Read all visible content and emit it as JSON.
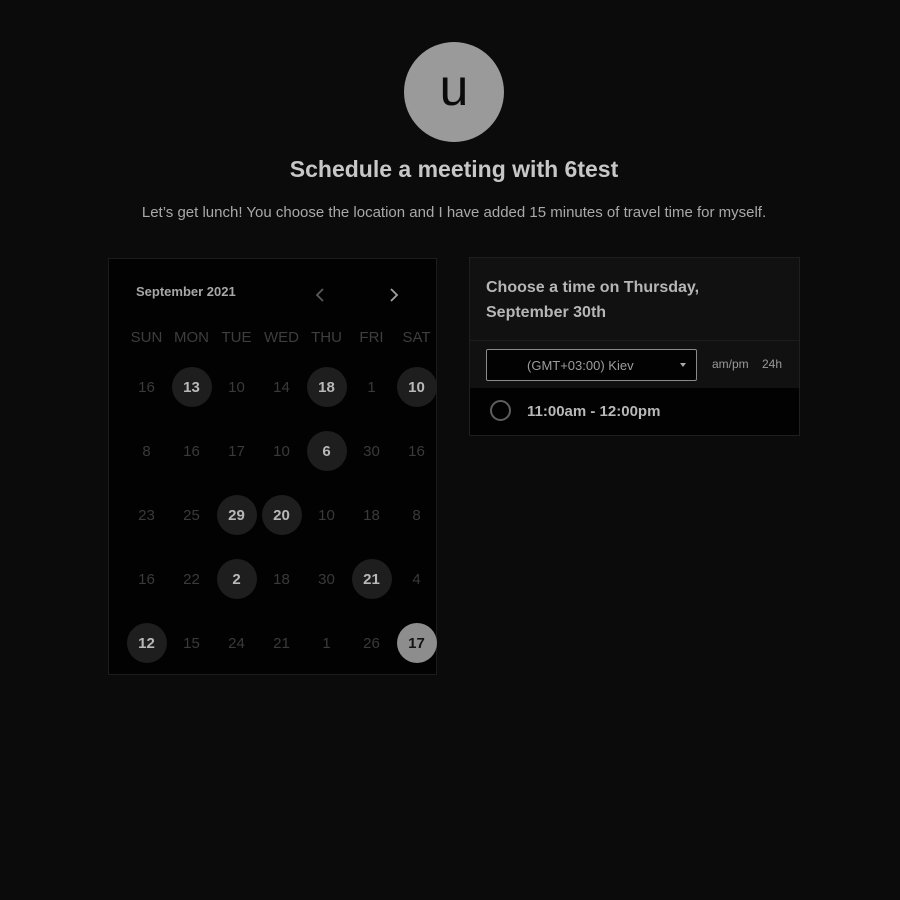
{
  "avatar": {
    "letter": "u"
  },
  "header": {
    "title": "Schedule a meeting with 6test",
    "subtitle": "Let’s get lunch! You choose the location and I have added 15 minutes of travel time for myself."
  },
  "calendar": {
    "month_label": "September 2021",
    "prev_icon": "chevron-left-icon",
    "next_icon": "chevron-right-icon",
    "weekdays": [
      "SUN",
      "MON",
      "TUE",
      "WED",
      "THU",
      "FRI",
      "SAT"
    ],
    "days": [
      {
        "label": "16",
        "state": "disabled"
      },
      {
        "label": "13",
        "state": "available"
      },
      {
        "label": "10",
        "state": "disabled"
      },
      {
        "label": "14",
        "state": "disabled"
      },
      {
        "label": "18",
        "state": "available"
      },
      {
        "label": "1",
        "state": "disabled"
      },
      {
        "label": "10",
        "state": "available"
      },
      {
        "label": "8",
        "state": "disabled"
      },
      {
        "label": "16",
        "state": "disabled"
      },
      {
        "label": "17",
        "state": "disabled"
      },
      {
        "label": "10",
        "state": "disabled"
      },
      {
        "label": "6",
        "state": "available"
      },
      {
        "label": "30",
        "state": "disabled"
      },
      {
        "label": "16",
        "state": "disabled"
      },
      {
        "label": "23",
        "state": "disabled"
      },
      {
        "label": "25",
        "state": "disabled"
      },
      {
        "label": "29",
        "state": "available"
      },
      {
        "label": "20",
        "state": "available"
      },
      {
        "label": "10",
        "state": "disabled"
      },
      {
        "label": "18",
        "state": "disabled"
      },
      {
        "label": "8",
        "state": "disabled"
      },
      {
        "label": "16",
        "state": "disabled"
      },
      {
        "label": "22",
        "state": "disabled"
      },
      {
        "label": "2",
        "state": "available"
      },
      {
        "label": "18",
        "state": "disabled"
      },
      {
        "label": "30",
        "state": "disabled"
      },
      {
        "label": "21",
        "state": "available"
      },
      {
        "label": "4",
        "state": "disabled"
      },
      {
        "label": "12",
        "state": "available"
      },
      {
        "label": "15",
        "state": "disabled"
      },
      {
        "label": "24",
        "state": "disabled"
      },
      {
        "label": "21",
        "state": "disabled"
      },
      {
        "label": "1",
        "state": "disabled"
      },
      {
        "label": "26",
        "state": "disabled"
      },
      {
        "label": "17",
        "state": "selected"
      }
    ]
  },
  "time_panel": {
    "heading": "Choose a time on Thursday, September 30th",
    "timezone": "(GMT+03:00) Kiev",
    "format_ampm": "am/pm",
    "format_24h": "24h",
    "slots": [
      {
        "label": "11:00am - 12:00pm"
      }
    ]
  }
}
